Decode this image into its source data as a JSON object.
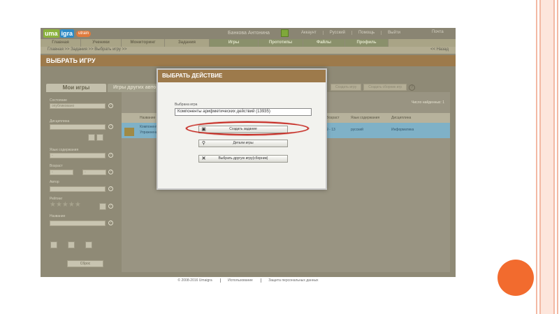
{
  "logo": {
    "part1": "uma",
    "part2": "igra",
    "part3": "utrain"
  },
  "user": {
    "name": "Банкова Антонина"
  },
  "top_links": [
    "Аккаунт",
    "Русский",
    "Помощь",
    "Выйти"
  ],
  "top_message": "Почта",
  "nav": [
    "Главная",
    "Ученики",
    "Мониторинг",
    "Задания",
    "Игры",
    "Прототипы",
    "Файлы",
    "Профиль"
  ],
  "breadcrumb": "Главная >> Задания >> Выбрать игру >>",
  "back_link": "<< Назад",
  "section_title": "ВЫБРАТЬ ИГРУ",
  "tabs": {
    "mine": "Мои игры",
    "others": "Игры других авторов"
  },
  "right_buttons": {
    "create": "Создать игру",
    "create_collection": "Создать сборник игр"
  },
  "sidebar": {
    "state_label": "Состояние",
    "state_value": "опубликовано",
    "discipline_label": "Дисциплина",
    "content_lang_label": "Язык содержания",
    "content_lang_value": "-",
    "age_label": "Возраст",
    "age_from": "-",
    "age_to": "-",
    "author_label": "Автор",
    "rating_label": "Рейтинг",
    "rating_stars": "★★★★★",
    "name_label": "Название",
    "reset_label": "Сброс"
  },
  "content": {
    "found_label": "Число найденных:",
    "found_count": "1",
    "columns": {
      "name": "Название",
      "age": "Возраст",
      "lang": "Язык содержания",
      "discipline": "Дисциплина"
    },
    "row": {
      "name": "Компоненты арифметических действий",
      "name2": "Упражнение",
      "age": "9 - 13",
      "lang": "русский",
      "discipline": "Информатика"
    }
  },
  "modal": {
    "title": "ВЫБРАТЬ ДЕЙСТВИЕ",
    "selected_label": "Выбрана игра",
    "selected_value": "Компоненты арифметических действий (13935)",
    "btn_create_task": "Создать задание",
    "btn_details": "Детали игры",
    "btn_choose_other": "Выбрать другую игру(сборник)"
  },
  "footer": {
    "copyright": "© 2008-2016 Umaigra",
    "terms": "Использование",
    "privacy": "Защита персональных данных"
  },
  "colors": {
    "accent_brown": "#9d7a4b",
    "highlight_red": "#c62a22",
    "slide_dot": "#f26b2e",
    "row_blue": "#7fb1c7"
  }
}
